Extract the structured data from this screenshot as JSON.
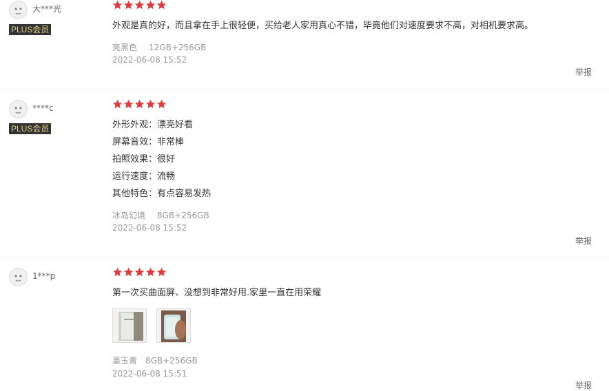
{
  "reviews": [
    {
      "username": "大***光",
      "badge": "PLUS会员",
      "rating": 5,
      "lines": [
        "外观是真的好，而且拿在手上很轻便，买给老人家用真心不错，毕竟他们对速度要求不高，对相机要求高。"
      ],
      "color": "亮黑色",
      "spec": "12GB+256GB",
      "date": "2022-06-08 15:52",
      "report": "举报"
    },
    {
      "username": "****c",
      "badge": "PLUS会员",
      "rating": 5,
      "lines": [
        "外形外观：漂亮好看",
        "屏幕音效：非常棒",
        "拍照效果：很好",
        "运行速度：流畅",
        "其他特色：有点容易发热"
      ],
      "color": "冰岛幻境",
      "spec": "8GB+256GB",
      "date": "2022-06-08 15:52",
      "report": "举报"
    },
    {
      "username": "1***p",
      "rating": 5,
      "lines": [
        "第一次买曲面屏、没想到非常好用.家里一直在用荣耀"
      ],
      "color": "墨玉青",
      "spec": "8GB+256GB",
      "date": "2022-06-08 15:51",
      "report": "举报"
    }
  ],
  "colors": {
    "star": "#e4393c",
    "badge_bg": "#333333",
    "badge_text": "#e5d178"
  }
}
